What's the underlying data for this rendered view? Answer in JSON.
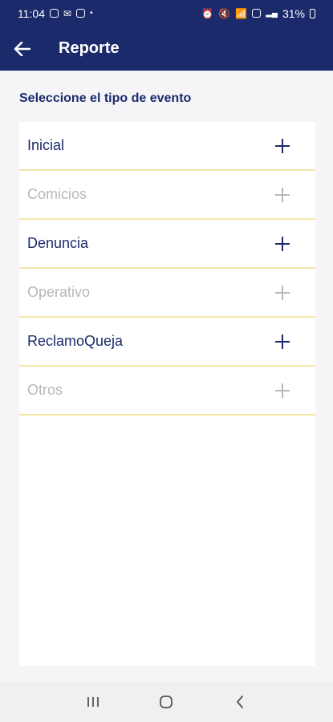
{
  "status_bar": {
    "time": "11:04",
    "battery": "31%",
    "dot": "•"
  },
  "app_bar": {
    "title": "Reporte"
  },
  "section": {
    "label": "Seleccione el tipo de evento"
  },
  "event_types": [
    {
      "label": "Inicial",
      "enabled": true
    },
    {
      "label": "Comicios",
      "enabled": false
    },
    {
      "label": "Denuncia",
      "enabled": true
    },
    {
      "label": "Operativo",
      "enabled": false
    },
    {
      "label": "ReclamoQueja",
      "enabled": true
    },
    {
      "label": "Otros",
      "enabled": false
    }
  ],
  "colors": {
    "primary": "#1b2a6b",
    "disabled": "#b8b8bc",
    "divider": "#f5e7a6",
    "background": "#f5f5f7"
  }
}
